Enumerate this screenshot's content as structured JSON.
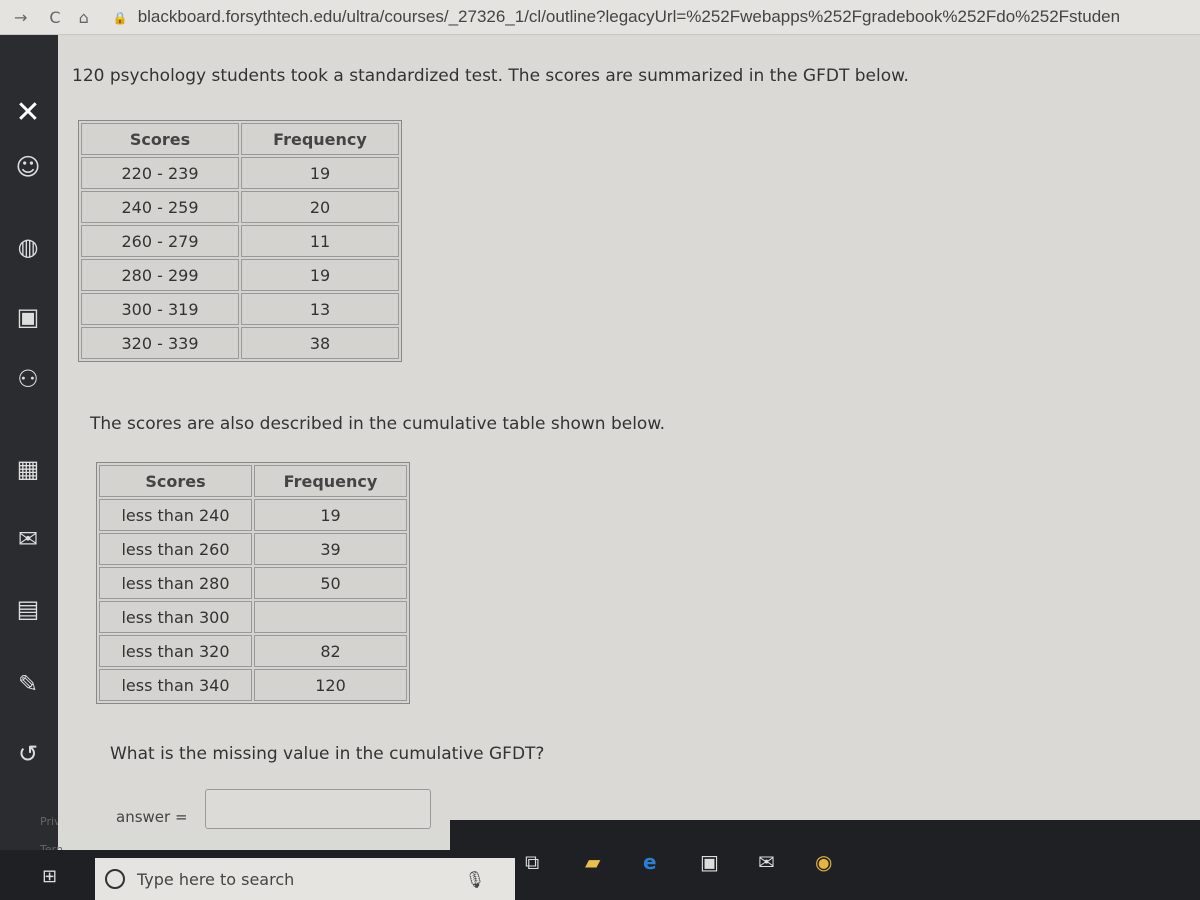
{
  "browser": {
    "url": "blackboard.forsythtech.edu/ultra/courses/_27326_1/cl/outline?legacyUrl=%252Fwebapps%252Fgradebook%252Fdo%252Fstuden"
  },
  "sidebar": {
    "footer_links": [
      "Priv",
      "Tern"
    ]
  },
  "question": {
    "intro": "120 psychology students took a standardized test. The scores are summarized in the GFDT below.",
    "table1": {
      "headers": [
        "Scores",
        "Frequency"
      ],
      "rows": [
        [
          "220 - 239",
          "19"
        ],
        [
          "240 - 259",
          "20"
        ],
        [
          "260 - 279",
          "11"
        ],
        [
          "280 - 299",
          "19"
        ],
        [
          "300 - 319",
          "13"
        ],
        [
          "320 - 339",
          "38"
        ]
      ]
    },
    "cumulative_intro": "The scores are also described in the cumulative table shown below.",
    "table2": {
      "headers": [
        "Scores",
        "Frequency"
      ],
      "rows": [
        [
          "less than 240",
          "19"
        ],
        [
          "less than 260",
          "39"
        ],
        [
          "less than 280",
          "50"
        ],
        [
          "less than 300",
          ""
        ],
        [
          "less than 320",
          "82"
        ],
        [
          "less than 340",
          "120"
        ]
      ]
    },
    "prompt": "What is the missing value in the cumulative GFDT?",
    "answer_label": "answer =",
    "answer_value": ""
  },
  "taskbar": {
    "search_placeholder": "Type here to search",
    "icons": [
      "windows-start-icon",
      "microphone-icon",
      "task-view-icon",
      "file-explorer-icon",
      "edge-icon",
      "store-icon",
      "mail-icon",
      "chrome-icon"
    ]
  }
}
